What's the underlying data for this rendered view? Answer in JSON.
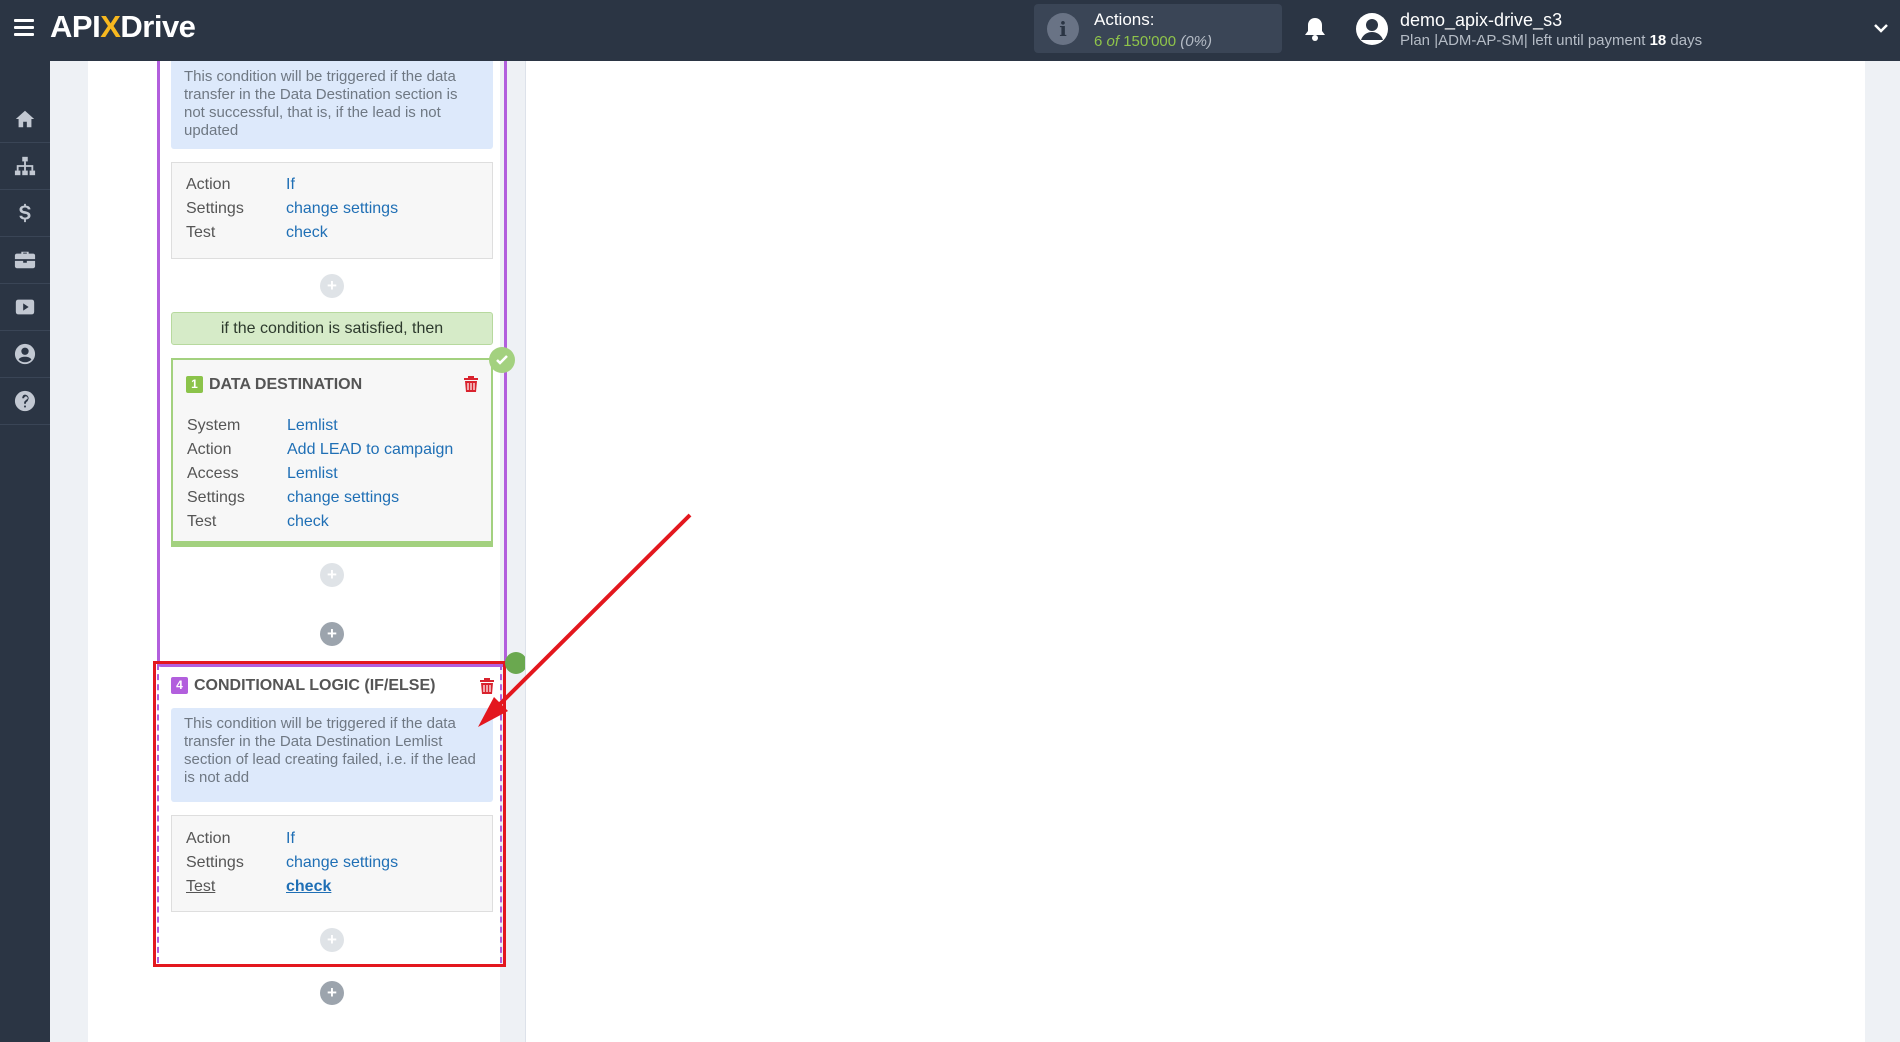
{
  "topbar": {
    "logo_left": "API",
    "logo_x": "X",
    "logo_right": "Drive",
    "actions_title": "Actions:",
    "actions_used": "6",
    "actions_of": "of",
    "actions_total": "150'000",
    "actions_pct": "(0%)",
    "username": "demo_apix-drive_s3",
    "plan_prefix": "Plan |ADM-AP-SM| left until payment",
    "plan_days": "18",
    "plan_suffix": "days"
  },
  "sidebar": {
    "items": [
      {
        "icon": "home-icon"
      },
      {
        "icon": "sitemap-icon"
      },
      {
        "icon": "dollar-icon"
      },
      {
        "icon": "briefcase-icon"
      },
      {
        "icon": "youtube-icon"
      },
      {
        "icon": "user-circle-icon"
      },
      {
        "icon": "question-icon"
      }
    ]
  },
  "block3": {
    "description": "This condition will be triggered if the data transfer in the Data Destination section is not successful, that is, if the lead is not updated",
    "rows": [
      {
        "label": "Action",
        "value": "If"
      },
      {
        "label": "Settings",
        "value": "change settings"
      },
      {
        "label": "Test",
        "value": "check"
      }
    ]
  },
  "condition_bar": "if the condition is satisfied, then",
  "destination": {
    "number": "1",
    "title": "DATA DESTINATION",
    "rows": [
      {
        "label": "System",
        "value": "Lemlist"
      },
      {
        "label": "Action",
        "value": "Add LEAD to campaign"
      },
      {
        "label": "Access",
        "value": "Lemlist"
      },
      {
        "label": "Settings",
        "value": "change settings"
      },
      {
        "label": "Test",
        "value": "check"
      }
    ]
  },
  "block4": {
    "number": "4",
    "title": "CONDITIONAL LOGIC (IF/ELSE)",
    "description": "This condition will be triggered if the data transfer in the Data Destination Lemlist section of lead creating failed, i.e. if the lead is not add",
    "rows": [
      {
        "label": "Action",
        "value": "If"
      },
      {
        "label": "Settings",
        "value": "change settings"
      },
      {
        "label": "Test",
        "value": "check"
      }
    ]
  },
  "plus_label": "+",
  "colors": {
    "topbar": "#2b3544",
    "accent_purple": "#b25fdd",
    "accent_green": "#a3d17f",
    "highlight_red": "#e3171e",
    "link_blue": "#1f6fb5"
  }
}
